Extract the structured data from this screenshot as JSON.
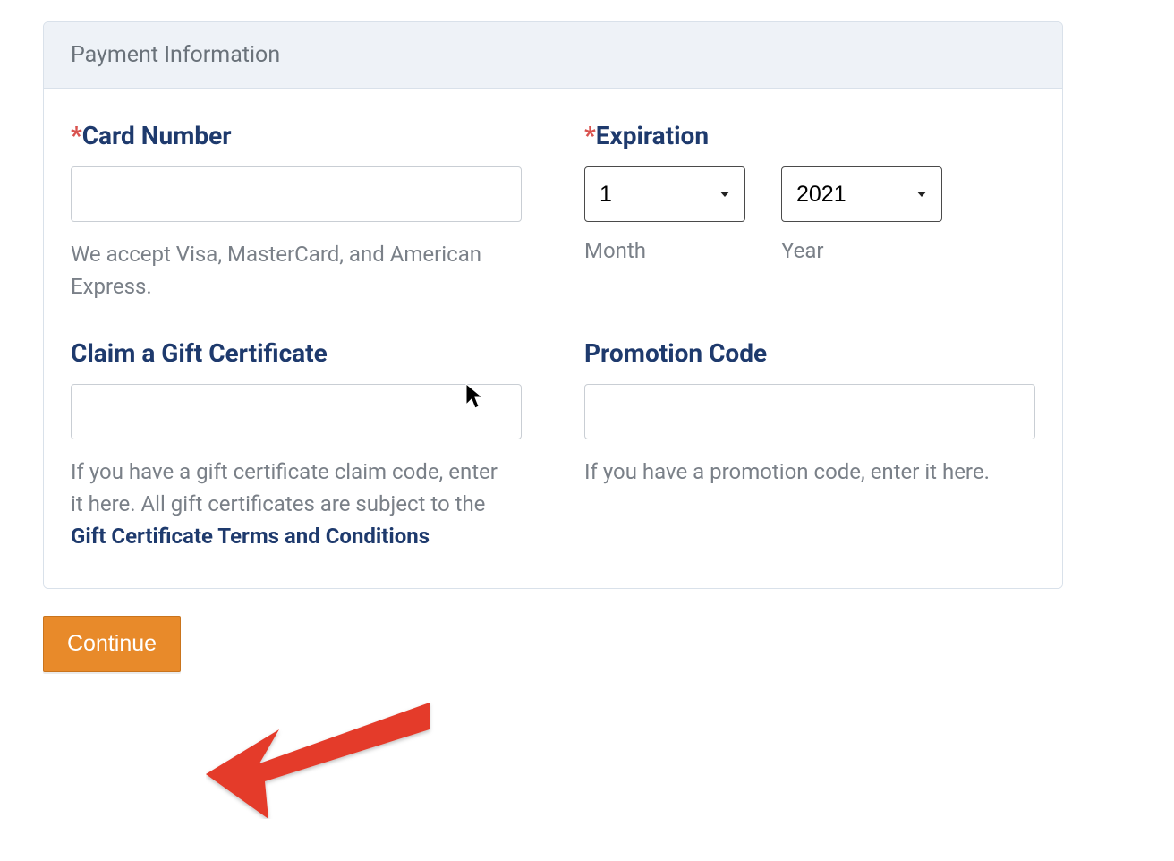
{
  "panel": {
    "title": "Payment Information"
  },
  "card": {
    "label": "Card Number",
    "value": "",
    "help": "We accept Visa, MasterCard, and American Express."
  },
  "expiration": {
    "label": "Expiration",
    "month_value": "1",
    "year_value": "2021",
    "month_sub": "Month",
    "year_sub": "Year"
  },
  "gift": {
    "label": "Claim a Gift Certificate",
    "value": "",
    "help_pre": "If you have a gift certificate claim code, enter it here. All gift certificates are subject to the ",
    "link": "Gift Certificate Terms and Conditions"
  },
  "promo": {
    "label": "Promotion Code",
    "value": "",
    "help": "If you have a promotion code, enter it here."
  },
  "continue_label": "Continue",
  "required_mark": "*"
}
